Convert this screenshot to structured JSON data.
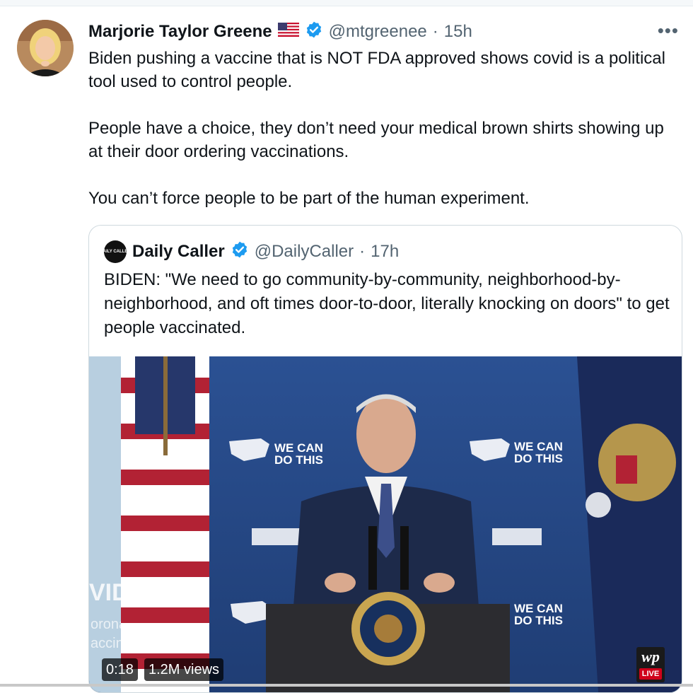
{
  "tweet": {
    "author_name": "Marjorie Taylor Greene",
    "flag_icon": "us-flag-icon",
    "handle": "@mtgreenee",
    "separator": "·",
    "time": "15h",
    "more_label": "•••",
    "paragraphs": [
      "Biden pushing a vaccine that is NOT FDA approved shows covid is a political tool used to control people.",
      "People have a choice, they don’t need your medical brown shirts showing up at their door ordering vaccinations.",
      "You can’t force people to be part of the human experiment."
    ]
  },
  "quoted": {
    "logo_text": "DAILY CALLER",
    "author_name": "Daily Caller",
    "handle": "@DailyCaller",
    "separator": "·",
    "time": "17h",
    "text": "BIDEN: \"We need to go community-by-community, neighborhood-by-neighborhood, and oft times door-to-door, literally knocking on doors\" to get people vaccinated."
  },
  "video": {
    "duration": "0:18",
    "views": "1.2M views",
    "backdrop_text": "WE CAN DO THIS",
    "backdrop_line1": "WE CAN",
    "backdrop_line2": "DO THIS",
    "side_text_1": "VID",
    "side_text_2": "oronavi",
    "side_text_3": "accine",
    "wp_logo": "wp",
    "wp_live": "LIVE"
  },
  "colors": {
    "verified": "#1d9bf0",
    "text_primary": "#0f1419",
    "text_secondary": "#536471",
    "border": "#cfd9de",
    "backdrop_blue": "#2a4a8a"
  }
}
